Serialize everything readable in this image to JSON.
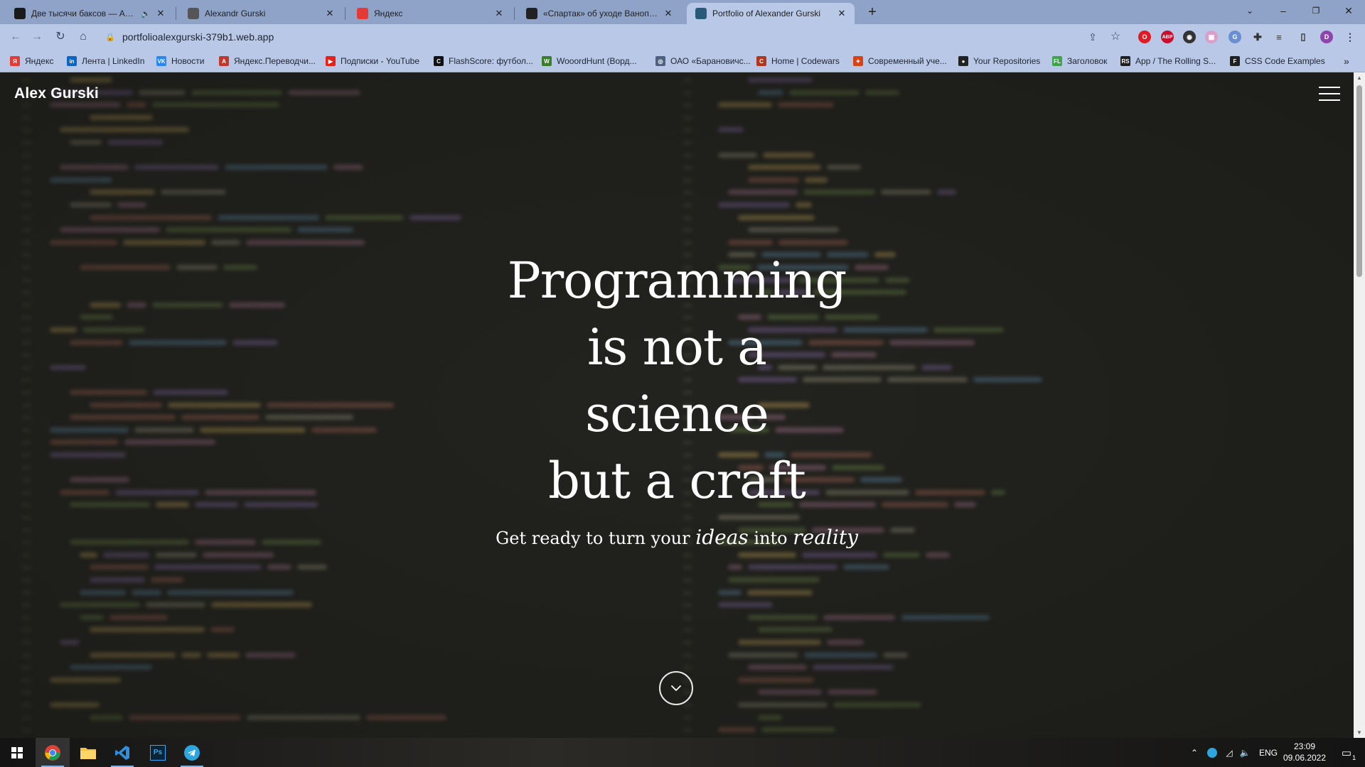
{
  "browser": {
    "tabs": [
      {
        "title": "Две тысячи баксов — Алекс",
        "icon": "youtube-play-icon",
        "color": "#1a1a1a",
        "muted": true,
        "active": false
      },
      {
        "title": "Alexandr Gurski",
        "icon": "globe-icon",
        "color": "#555555",
        "muted": false,
        "active": false
      },
      {
        "title": "Яндекс",
        "icon": "yandex-icon",
        "color": "#e53935",
        "muted": false,
        "active": false
      },
      {
        "title": "«Спартак» об уходе Ванопи: «К",
        "icon": "sports-s-icon",
        "color": "#222222",
        "muted": false,
        "active": false
      },
      {
        "title": "Portfolio of Alexander Gurski",
        "icon": "portfolio-icon",
        "color": "#2a5a7a",
        "muted": false,
        "active": true
      }
    ],
    "new_tab_label": "+",
    "url": "portfolioalexgurski-379b1.web.app",
    "bookmarks": [
      {
        "label": "Яндекс",
        "icon": "yandex-icon",
        "color": "#e53935",
        "glyph": "Я"
      },
      {
        "label": "Лента | LinkedIn",
        "icon": "linkedin-icon",
        "color": "#0a66c2",
        "glyph": "in"
      },
      {
        "label": "Новости",
        "icon": "vk-icon",
        "color": "#2787f5",
        "glyph": "VK"
      },
      {
        "label": "Яндекс.Переводчи...",
        "icon": "translate-icon",
        "color": "#c0392b",
        "glyph": "A"
      },
      {
        "label": "Подписки - YouTube",
        "icon": "youtube-icon",
        "color": "#e62117",
        "glyph": "▶"
      },
      {
        "label": "FlashScore: футбол...",
        "icon": "flashscore-icon",
        "color": "#111111",
        "glyph": "C"
      },
      {
        "label": "WooordHunt (Ворд...",
        "icon": "wooordhunt-icon",
        "color": "#3a7d2a",
        "glyph": "W"
      },
      {
        "label": "ОАО «Барановичс...",
        "icon": "globe-icon",
        "color": "#506080",
        "glyph": "◎"
      },
      {
        "label": "Home | Codewars",
        "icon": "codewars-icon",
        "color": "#b1361e",
        "glyph": "C"
      },
      {
        "label": "Современный уче...",
        "icon": "learn-js-icon",
        "color": "#d84315",
        "glyph": "✦"
      },
      {
        "label": "Your Repositories",
        "icon": "github-icon",
        "color": "#222222",
        "glyph": "●"
      },
      {
        "label": "Заголовок",
        "icon": "fl-icon",
        "color": "#3fa34d",
        "glyph": "FL"
      },
      {
        "label": "App / The Rolling S...",
        "icon": "rs-icon",
        "color": "#1f1f1f",
        "glyph": "RS"
      },
      {
        "label": "CSS Code Examples",
        "icon": "css-examples-icon",
        "color": "#1f1f1f",
        "glyph": "F"
      }
    ],
    "more_bookmarks_label": "»",
    "profile_initial": "D"
  },
  "page": {
    "brand": "Alex Gurski",
    "hero_lines": [
      "Programming",
      "is not a",
      "science",
      "but a craft"
    ],
    "tagline": {
      "before": "Get ready to turn your",
      "word1": "ideas",
      "middle": "into",
      "word2": "reality"
    }
  },
  "taskbar": {
    "apps": [
      {
        "name": "start-button",
        "icon": "windows-icon"
      },
      {
        "name": "taskbar-chrome",
        "icon": "chrome-icon"
      },
      {
        "name": "taskbar-explorer",
        "icon": "folder-icon"
      },
      {
        "name": "taskbar-vscode",
        "icon": "vscode-icon"
      },
      {
        "name": "taskbar-photoshop",
        "icon": "photoshop-icon",
        "label": "Ps"
      },
      {
        "name": "taskbar-telegram",
        "icon": "telegram-icon"
      }
    ],
    "language": "ENG",
    "time": "23:09",
    "date": "09.06.2022",
    "notification_count": "1"
  }
}
